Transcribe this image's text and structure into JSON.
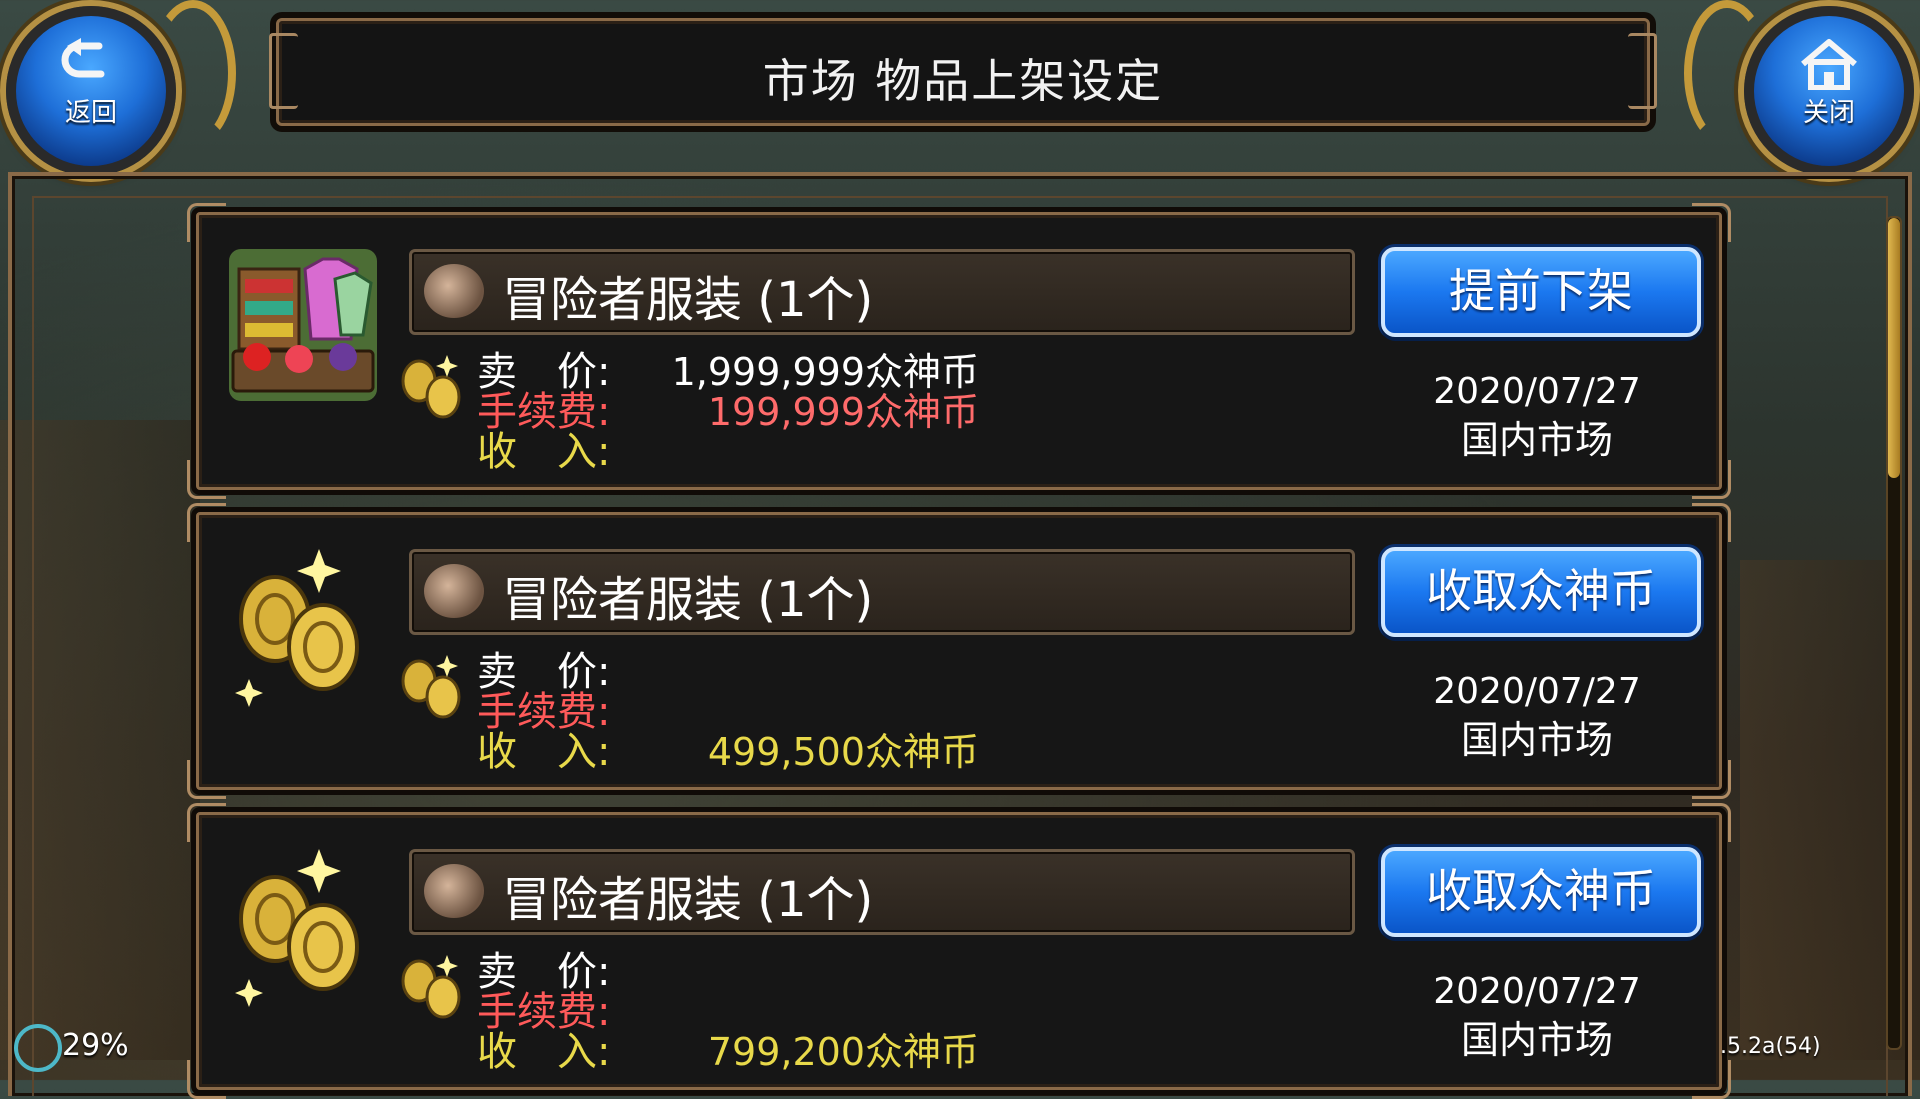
{
  "header": {
    "title": "市场 物品上架设定",
    "back_label": "返回",
    "close_label": "关闭"
  },
  "listings": [
    {
      "item_name": "冒险者服装 (1个)",
      "action_label": "提前下架",
      "price_label": "卖　价:",
      "price_value": "1,999,999众神币",
      "fee_label": "手续费:",
      "fee_value": "199,999众神币",
      "income_label": "收　入:",
      "income_value": "",
      "date": "2020/07/27",
      "market": "国内市场"
    },
    {
      "item_name": "冒险者服装 (1个)",
      "action_label": "收取众神币",
      "price_label": "卖　价:",
      "price_value": "",
      "fee_label": "手续费:",
      "fee_value": "",
      "income_label": "收　入:",
      "income_value": "499,500众神币",
      "date": "2020/07/27",
      "market": "国内市场"
    },
    {
      "item_name": "冒险者服装 (1个)",
      "action_label": "收取众神币",
      "price_label": "卖　价:",
      "price_value": "",
      "fee_label": "手续费:",
      "fee_value": "",
      "income_label": "收　入:",
      "income_value": "799,200众神币",
      "date": "2020/07/27",
      "market": "国内市场"
    }
  ],
  "status": {
    "battery": "29%",
    "version": ".5.2a(54)"
  },
  "colors": {
    "button_blue": "#1b78f0",
    "fee_red": "#ff5a5a",
    "income_yellow": "#e8d94a",
    "frame_brown": "#8a6a48"
  },
  "icons": {
    "back": "back-arrow-icon",
    "close": "home-icon",
    "shop_item": "market-stall-icon",
    "coins": "gold-coins-icon",
    "item": "clothing-icon"
  }
}
